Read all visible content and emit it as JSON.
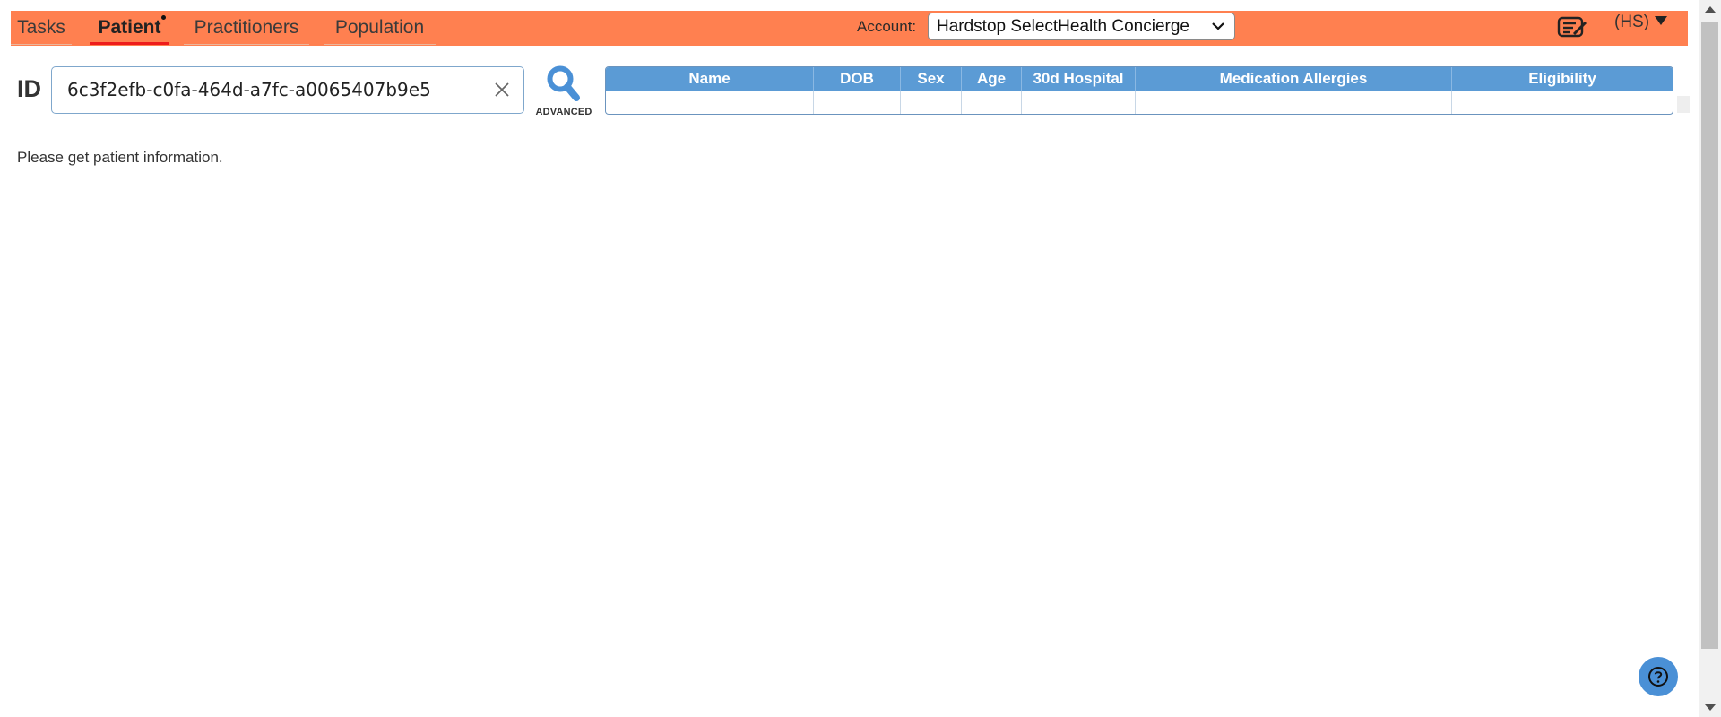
{
  "nav": {
    "tabs": [
      {
        "label": "Tasks",
        "active": false
      },
      {
        "label": "Patient",
        "active": true,
        "has_dot": true
      },
      {
        "label": "Practitioners",
        "active": false
      },
      {
        "label": "Population",
        "active": false
      }
    ],
    "account_label": "Account:",
    "account_value": "Hardstop SelectHealth Concierge",
    "user_initials": "(HS)",
    "bar_color": "#ff8050",
    "active_underline_color": "#ee1c1c"
  },
  "search": {
    "id_label": "ID",
    "id_value": "6c3f2efb-c0fa-464d-a7fc-a0065407b9e5",
    "advanced_label": "ADVANCED"
  },
  "patient_table": {
    "columns": [
      "Name",
      "DOB",
      "Sex",
      "Age",
      "30d Hospital",
      "Medication Allergies",
      "Eligibility"
    ],
    "rows": [
      [
        "",
        "",
        "",
        "",
        "",
        "",
        ""
      ]
    ],
    "header_color": "#5b9bd5"
  },
  "status_message": "Please get patient information.",
  "icons": {
    "notes": "notes-edit-icon",
    "search": "search-icon",
    "clear": "close-icon",
    "help": "help-icon",
    "dropdown": "chevron-down-icon"
  }
}
